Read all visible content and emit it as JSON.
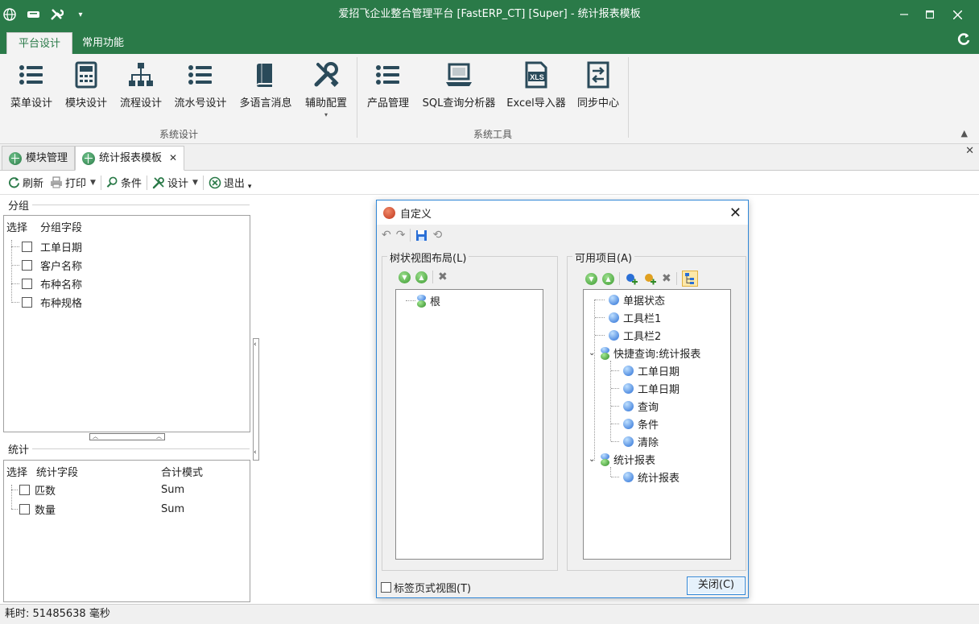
{
  "window": {
    "title": "爱招飞企业整合管理平台 [FastERP_CT] [Super] - 统计报表模板",
    "accent_color": "#2a7a48"
  },
  "ribbon": {
    "tabs": [
      {
        "label": "平台设计",
        "active": true
      },
      {
        "label": "常用功能",
        "active": false
      }
    ],
    "groups": [
      {
        "label": "系统设计",
        "buttons": [
          {
            "label": "菜单设计",
            "icon": "list-icon"
          },
          {
            "label": "模块设计",
            "icon": "calculator-icon"
          },
          {
            "label": "流程设计",
            "icon": "org-chart-icon"
          },
          {
            "label": "流水号设计",
            "icon": "list-icon"
          },
          {
            "label": "多语言消息",
            "icon": "book-icon"
          },
          {
            "label": "辅助配置",
            "icon": "tools-icon"
          }
        ]
      },
      {
        "label": "系统工具",
        "buttons": [
          {
            "label": "产品管理",
            "icon": "list-icon"
          },
          {
            "label": "SQL查询分析器",
            "icon": "laptop-icon"
          },
          {
            "label": "Excel导入器",
            "icon": "xls-icon",
            "badge": "XLS"
          },
          {
            "label": "同步中心",
            "icon": "sync-icon"
          }
        ]
      }
    ]
  },
  "doc_tabs": [
    {
      "label": "模块管理",
      "active": false
    },
    {
      "label": "统计报表模板",
      "active": true
    }
  ],
  "toolbar": {
    "refresh": "刷新",
    "print": "打印",
    "condition": "条件",
    "design": "设计",
    "exit": "退出"
  },
  "group_panel": {
    "title": "分组",
    "col_select": "选择",
    "col_field": "分组字段",
    "rows": [
      "工单日期",
      "客户名称",
      "布种名称",
      "布种规格"
    ]
  },
  "stats_panel": {
    "title": "统计",
    "col_select": "选择",
    "col_field": "统计字段",
    "col_mode": "合计模式",
    "rows": [
      {
        "field": "匹数",
        "mode": "Sum"
      },
      {
        "field": "数量",
        "mode": "Sum"
      }
    ]
  },
  "dialog": {
    "title": "自定义",
    "left_group": "树状视图布局(L)",
    "right_group": "可用项目(A)",
    "left_tree": [
      {
        "label": "根",
        "kind": "group"
      }
    ],
    "right_tree": [
      {
        "label": "单据状态",
        "kind": "item",
        "level": 0
      },
      {
        "label": "工具栏1",
        "kind": "item",
        "level": 0
      },
      {
        "label": "工具栏2",
        "kind": "item",
        "level": 0
      },
      {
        "label": "快捷查询:统计报表",
        "kind": "group",
        "level": 0
      },
      {
        "label": "工单日期",
        "kind": "item",
        "level": 1
      },
      {
        "label": "工单日期",
        "kind": "item",
        "level": 1
      },
      {
        "label": "查询",
        "kind": "item",
        "level": 1
      },
      {
        "label": "条件",
        "kind": "item",
        "level": 1
      },
      {
        "label": "清除",
        "kind": "item",
        "level": 1
      },
      {
        "label": "统计报表",
        "kind": "group",
        "level": 0
      },
      {
        "label": "统计报表",
        "kind": "item",
        "level": 1
      }
    ],
    "tab_view_checkbox": "标签页式视图(T)",
    "close_button": "关闭(C)"
  },
  "status": {
    "text": "耗时: 51485638 毫秒"
  }
}
